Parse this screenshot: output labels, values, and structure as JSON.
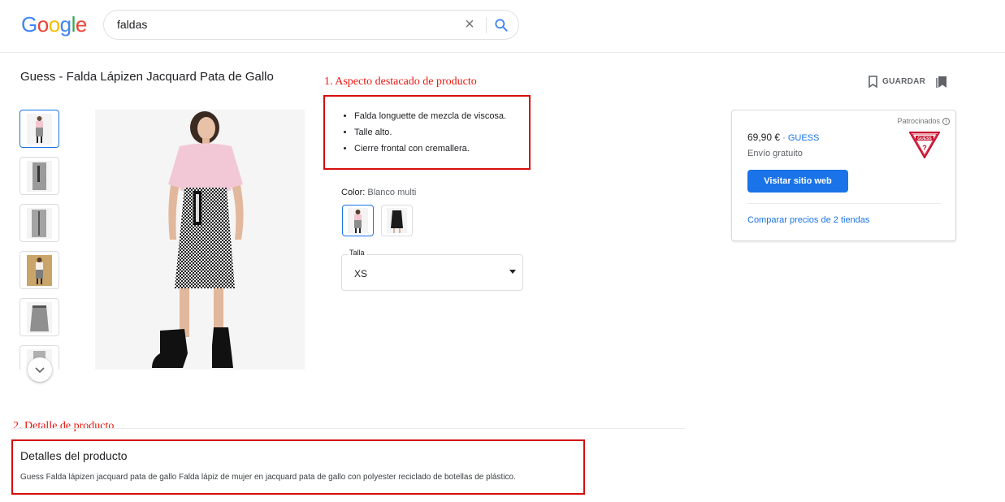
{
  "header": {
    "logo_letters": [
      {
        "ch": "G",
        "color": "#4285F4"
      },
      {
        "ch": "o",
        "color": "#EA4335"
      },
      {
        "ch": "o",
        "color": "#FBBC05"
      },
      {
        "ch": "g",
        "color": "#4285F4"
      },
      {
        "ch": "l",
        "color": "#34A853"
      },
      {
        "ch": "e",
        "color": "#EA4335"
      }
    ],
    "search_value": "faldas",
    "clear_icon": "close-icon",
    "search_icon": "search-icon"
  },
  "product": {
    "title": "Guess - Falda Lápizen Jacquard Pata de Gallo",
    "save_label": "GUARDAR",
    "highlights": [
      "Falda longuette de mezcla de viscosa.",
      "Talle alto.",
      "Cierre frontal con cremallera."
    ],
    "color_label": "Color:",
    "color_value": "Blanco multi",
    "size_label": "Talla",
    "size_value": "XS"
  },
  "annotations": {
    "a1": "1. Aspecto destacado de producto",
    "a2": "2. Detalle de producto"
  },
  "offer": {
    "sponsored": "Patrocinados",
    "price": "69,90 €",
    "price_sep": " · ",
    "store": "GUESS",
    "shipping": "Envío gratuito",
    "visit_button": "Visitar sitio web",
    "compare_link": "Comparar precios de 2 tiendas"
  },
  "details": {
    "heading": "Detalles del producto",
    "text": "Guess Falda lápizen jacquard pata de gallo Falda lápiz de mujer en jacquard pata de gallo con polyester reciclado de botellas de plástico."
  },
  "colors": {
    "accent": "#1a73e8",
    "annotation_red": "#d50d0d"
  }
}
